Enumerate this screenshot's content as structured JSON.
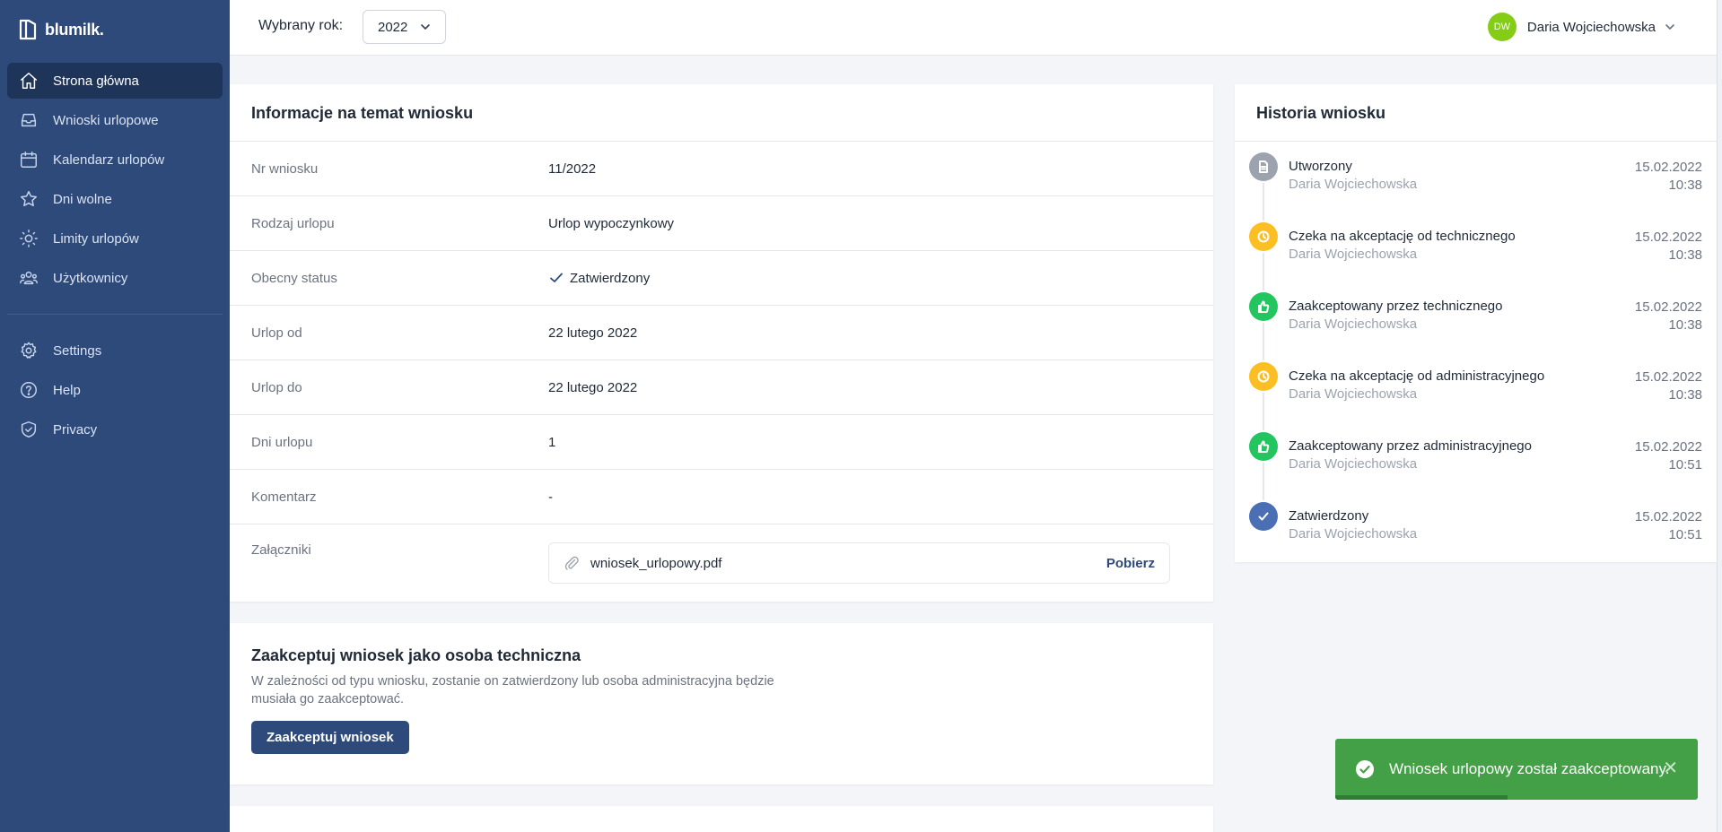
{
  "brand": {
    "name": "blumilk."
  },
  "sidebar": {
    "main_items": [
      {
        "label": "Strona główna",
        "icon": "home-icon",
        "active": true
      },
      {
        "label": "Wnioski urlopowe",
        "icon": "inbox-icon",
        "active": false
      },
      {
        "label": "Kalendarz urlopów",
        "icon": "calendar-icon",
        "active": false
      },
      {
        "label": "Dni wolne",
        "icon": "star-icon",
        "active": false
      },
      {
        "label": "Limity urlopów",
        "icon": "sun-icon",
        "active": false
      },
      {
        "label": "Użytkownicy",
        "icon": "users-icon",
        "active": false
      }
    ],
    "secondary_items": [
      {
        "label": "Settings",
        "icon": "gear-icon"
      },
      {
        "label": "Help",
        "icon": "help-icon"
      },
      {
        "label": "Privacy",
        "icon": "shield-icon"
      }
    ]
  },
  "topbar": {
    "year_label": "Wybrany rok:",
    "year_value": "2022",
    "user": {
      "initials": "DW",
      "name": "Daria Wojciechowska"
    }
  },
  "info": {
    "title": "Informacje na temat wniosku",
    "rows": [
      {
        "label": "Nr wniosku",
        "value": "11/2022"
      },
      {
        "label": "Rodzaj urlopu",
        "value": "Urlop wypoczynkowy"
      },
      {
        "label": "Obecny status",
        "value": "Zatwierdzony"
      },
      {
        "label": "Urlop od",
        "value": "22 lutego 2022"
      },
      {
        "label": "Urlop do",
        "value": "22 lutego 2022"
      },
      {
        "label": "Dni urlopu",
        "value": "1"
      },
      {
        "label": "Komentarz",
        "value": "-"
      }
    ],
    "attachments_label": "Załączniki",
    "attachment": {
      "file": "wniosek_urlopowy.pdf",
      "download": "Pobierz"
    }
  },
  "accept": {
    "title": "Zaakceptuj wniosek jako osoba techniczna",
    "description": "W zależności od typu wniosku, zostanie on zatwierdzony lub osoba administracyjna będzie musiała go zaakceptować.",
    "button": "Zaakceptuj wniosek"
  },
  "history": {
    "title": "Historia wniosku",
    "items": [
      {
        "title": "Utworzony",
        "user": "Daria Wojciechowska",
        "date": "15.02.2022",
        "time": "10:38",
        "icon": "document-icon",
        "color": "#9ca3af"
      },
      {
        "title": "Czeka na akceptację od technicznego",
        "user": "Daria Wojciechowska",
        "date": "15.02.2022",
        "time": "10:38",
        "icon": "clock-icon",
        "color": "#fbbf24"
      },
      {
        "title": "Zaakceptowany przez technicznego",
        "user": "Daria Wojciechowska",
        "date": "15.02.2022",
        "time": "10:38",
        "icon": "thumb-up-icon",
        "color": "#22c55e"
      },
      {
        "title": "Czeka na akceptację od administracyjnego",
        "user": "Daria Wojciechowska",
        "date": "15.02.2022",
        "time": "10:38",
        "icon": "clock-icon",
        "color": "#fbbf24"
      },
      {
        "title": "Zaakceptowany przez administracyjnego",
        "user": "Daria Wojciechowska",
        "date": "15.02.2022",
        "time": "10:51",
        "icon": "thumb-up-icon",
        "color": "#22c55e"
      },
      {
        "title": "Zatwierdzony",
        "user": "Daria Wojciechowska",
        "date": "15.02.2022",
        "time": "10:51",
        "icon": "check-icon",
        "color": "#4a6fb5"
      }
    ]
  },
  "toast": {
    "message": "Wniosek urlopowy został zaakceptowany.",
    "close": "✕"
  },
  "colors": {
    "sidebar": "#2d4a7a",
    "sidebar_active": "#1f3459",
    "toast": "#43a047",
    "avatar": "#84cc16"
  }
}
